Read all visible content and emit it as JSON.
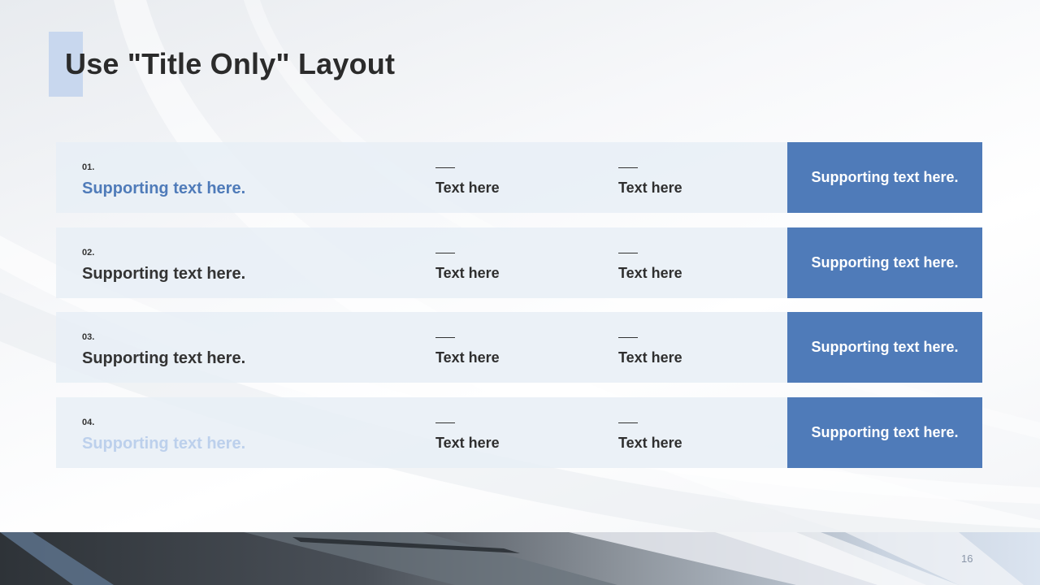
{
  "slide": {
    "title": "Use \"Title Only\" Layout",
    "page_number": "16"
  },
  "colors": {
    "accent_blue": "#4f7bb9",
    "light_blue": "#c8d7ee",
    "row_bg": "#e8eef6"
  },
  "rows": [
    {
      "number": "01.",
      "supporting": "Supporting text here.",
      "supporting_color": "#4f7bb9",
      "col1": "Text here",
      "col2": "Text here",
      "box": "Supporting text here."
    },
    {
      "number": "02.",
      "supporting": "Supporting text here.",
      "supporting_color": "#333333",
      "col1": "Text here",
      "col2": "Text here",
      "box": "Supporting text here."
    },
    {
      "number": "03.",
      "supporting": "Supporting text here.",
      "supporting_color": "#333333",
      "col1": "Text here",
      "col2": "Text here",
      "box": "Supporting text here."
    },
    {
      "number": "04.",
      "supporting": "Supporting text here.",
      "supporting_color": "#bcd0ec",
      "col1": "Text here",
      "col2": "Text here",
      "box": "Supporting text here."
    }
  ]
}
